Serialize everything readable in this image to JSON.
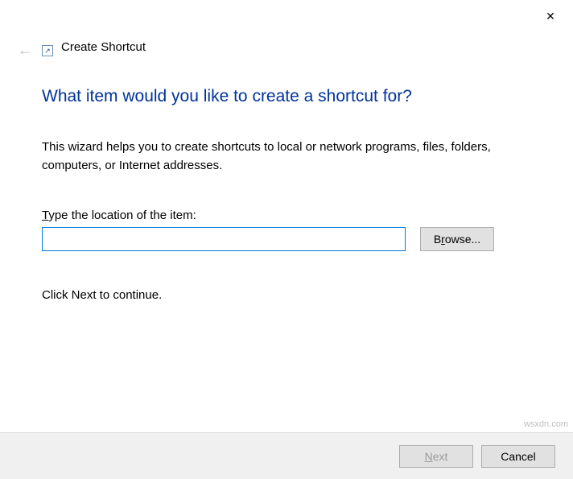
{
  "window": {
    "title": "Create Shortcut",
    "close": "✕",
    "back": "←"
  },
  "heading": "What item would you like to create a shortcut for?",
  "description": "This wizard helps you to create shortcuts to local or network programs, files, folders, computers, or Internet addresses.",
  "field": {
    "label": "Type the location of the item:",
    "value": "",
    "browse_prefix": "B",
    "browse_mid": "r",
    "browse_suffix": "owse..."
  },
  "continue_text": "Click Next to continue.",
  "footer": {
    "next_underline": "N",
    "next_rest": "ext",
    "cancel": "Cancel"
  },
  "watermark": "wsxdn.com"
}
